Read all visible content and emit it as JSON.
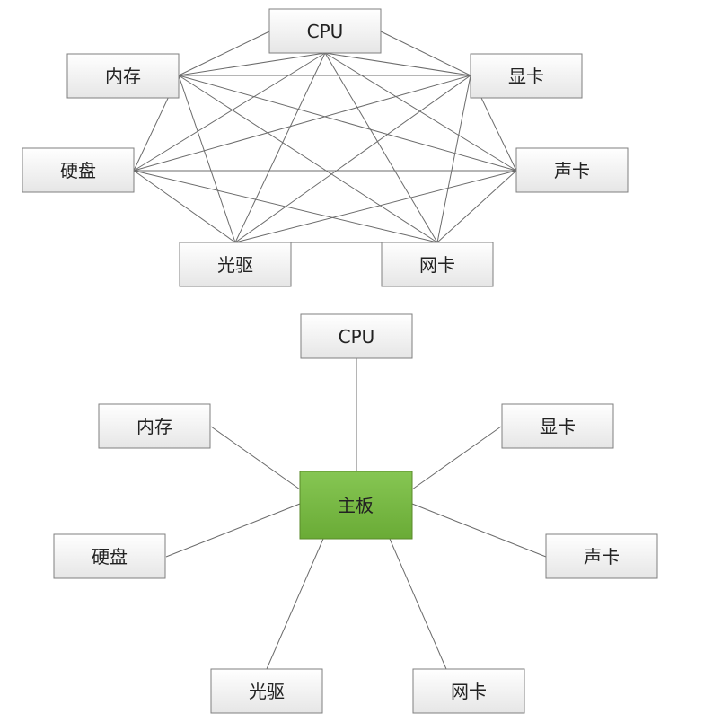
{
  "top_diagram": {
    "nodes": [
      {
        "id": "cpu",
        "label": "CPU"
      },
      {
        "id": "mem",
        "label": "内存"
      },
      {
        "id": "gpu",
        "label": "显卡"
      },
      {
        "id": "hdd",
        "label": "硬盘"
      },
      {
        "id": "snd",
        "label": "声卡"
      },
      {
        "id": "odd",
        "label": "光驱"
      },
      {
        "id": "nic",
        "label": "网卡"
      }
    ],
    "edges": "fully connected mesh (every component linked to every other)"
  },
  "bottom_diagram": {
    "hub": {
      "id": "mb",
      "label": "主板",
      "color": "#77b843"
    },
    "nodes": [
      {
        "id": "cpu",
        "label": "CPU"
      },
      {
        "id": "mem",
        "label": "内存"
      },
      {
        "id": "gpu",
        "label": "显卡"
      },
      {
        "id": "hdd",
        "label": "硬盘"
      },
      {
        "id": "snd",
        "label": "声卡"
      },
      {
        "id": "odd",
        "label": "光驱"
      },
      {
        "id": "nic",
        "label": "网卡"
      }
    ],
    "edges": "star topology (every component linked to 主板)"
  },
  "colors": {
    "box_fill": "#f2f2f2",
    "box_border": "#7f7f7f",
    "hub_fill": "#77b843",
    "line": "#6b6b6b"
  }
}
